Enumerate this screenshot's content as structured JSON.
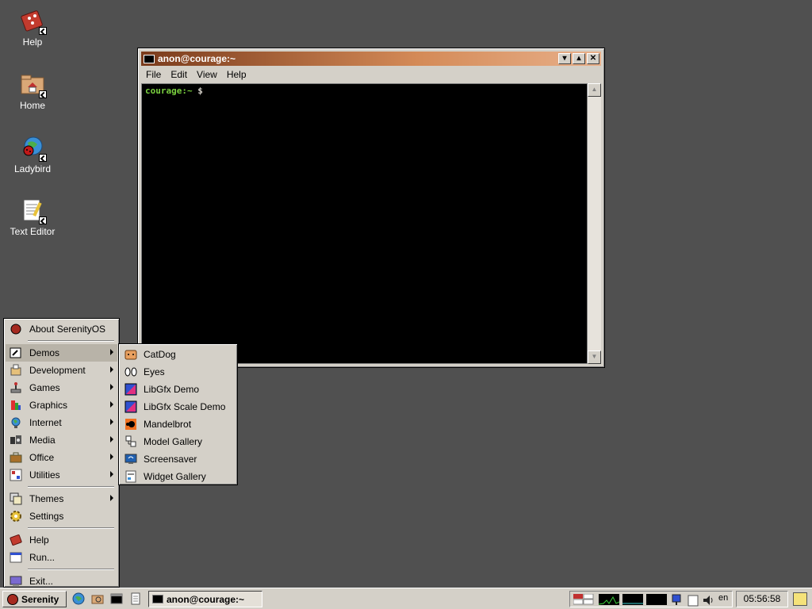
{
  "desktop": {
    "icons": [
      {
        "label": "Help",
        "icon": "help-book-icon"
      },
      {
        "label": "Home",
        "icon": "home-folder-icon"
      },
      {
        "label": "Ladybird",
        "icon": "ladybird-browser-icon"
      },
      {
        "label": "Text Editor",
        "icon": "text-editor-icon"
      }
    ]
  },
  "terminal": {
    "title": "anon@courage:~",
    "menu": [
      "File",
      "Edit",
      "View",
      "Help"
    ],
    "prompt_host": "courage:~",
    "prompt_symbol": "$"
  },
  "start_menu": {
    "items": [
      {
        "label": "About SerenityOS",
        "icon": "serenity-logo-icon"
      },
      {
        "label": "Demos",
        "icon": "demos-icon",
        "submenu": true
      },
      {
        "label": "Development",
        "icon": "development-icon",
        "submenu": true
      },
      {
        "label": "Games",
        "icon": "games-joystick-icon",
        "submenu": true
      },
      {
        "label": "Graphics",
        "icon": "graphics-icon",
        "submenu": true
      },
      {
        "label": "Internet",
        "icon": "internet-globe-icon",
        "submenu": true
      },
      {
        "label": "Media",
        "icon": "media-icon",
        "submenu": true
      },
      {
        "label": "Office",
        "icon": "office-briefcase-icon",
        "submenu": true
      },
      {
        "label": "Utilities",
        "icon": "utilities-icon",
        "submenu": true
      },
      {
        "label": "Themes",
        "icon": "themes-icon",
        "submenu": true
      },
      {
        "label": "Settings",
        "icon": "settings-gear-icon"
      },
      {
        "label": "Help",
        "icon": "help-book-icon"
      },
      {
        "label": "Run...",
        "icon": "run-icon"
      },
      {
        "label": "Exit...",
        "icon": "exit-icon"
      }
    ]
  },
  "demos_menu": {
    "items": [
      {
        "label": "CatDog",
        "icon": "catdog-icon"
      },
      {
        "label": "Eyes",
        "icon": "eyes-icon"
      },
      {
        "label": "LibGfx Demo",
        "icon": "libgfx-demo-icon"
      },
      {
        "label": "LibGfx Scale Demo",
        "icon": "libgfx-scale-demo-icon"
      },
      {
        "label": "Mandelbrot",
        "icon": "mandelbrot-icon"
      },
      {
        "label": "Model Gallery",
        "icon": "model-gallery-icon"
      },
      {
        "label": "Screensaver",
        "icon": "screensaver-icon"
      },
      {
        "label": "Widget Gallery",
        "icon": "widget-gallery-icon"
      }
    ]
  },
  "taskbar": {
    "start_label": "Serenity",
    "task_label": "anon@courage:~",
    "keyboard_layout": "en",
    "clock": "05:56:58"
  }
}
